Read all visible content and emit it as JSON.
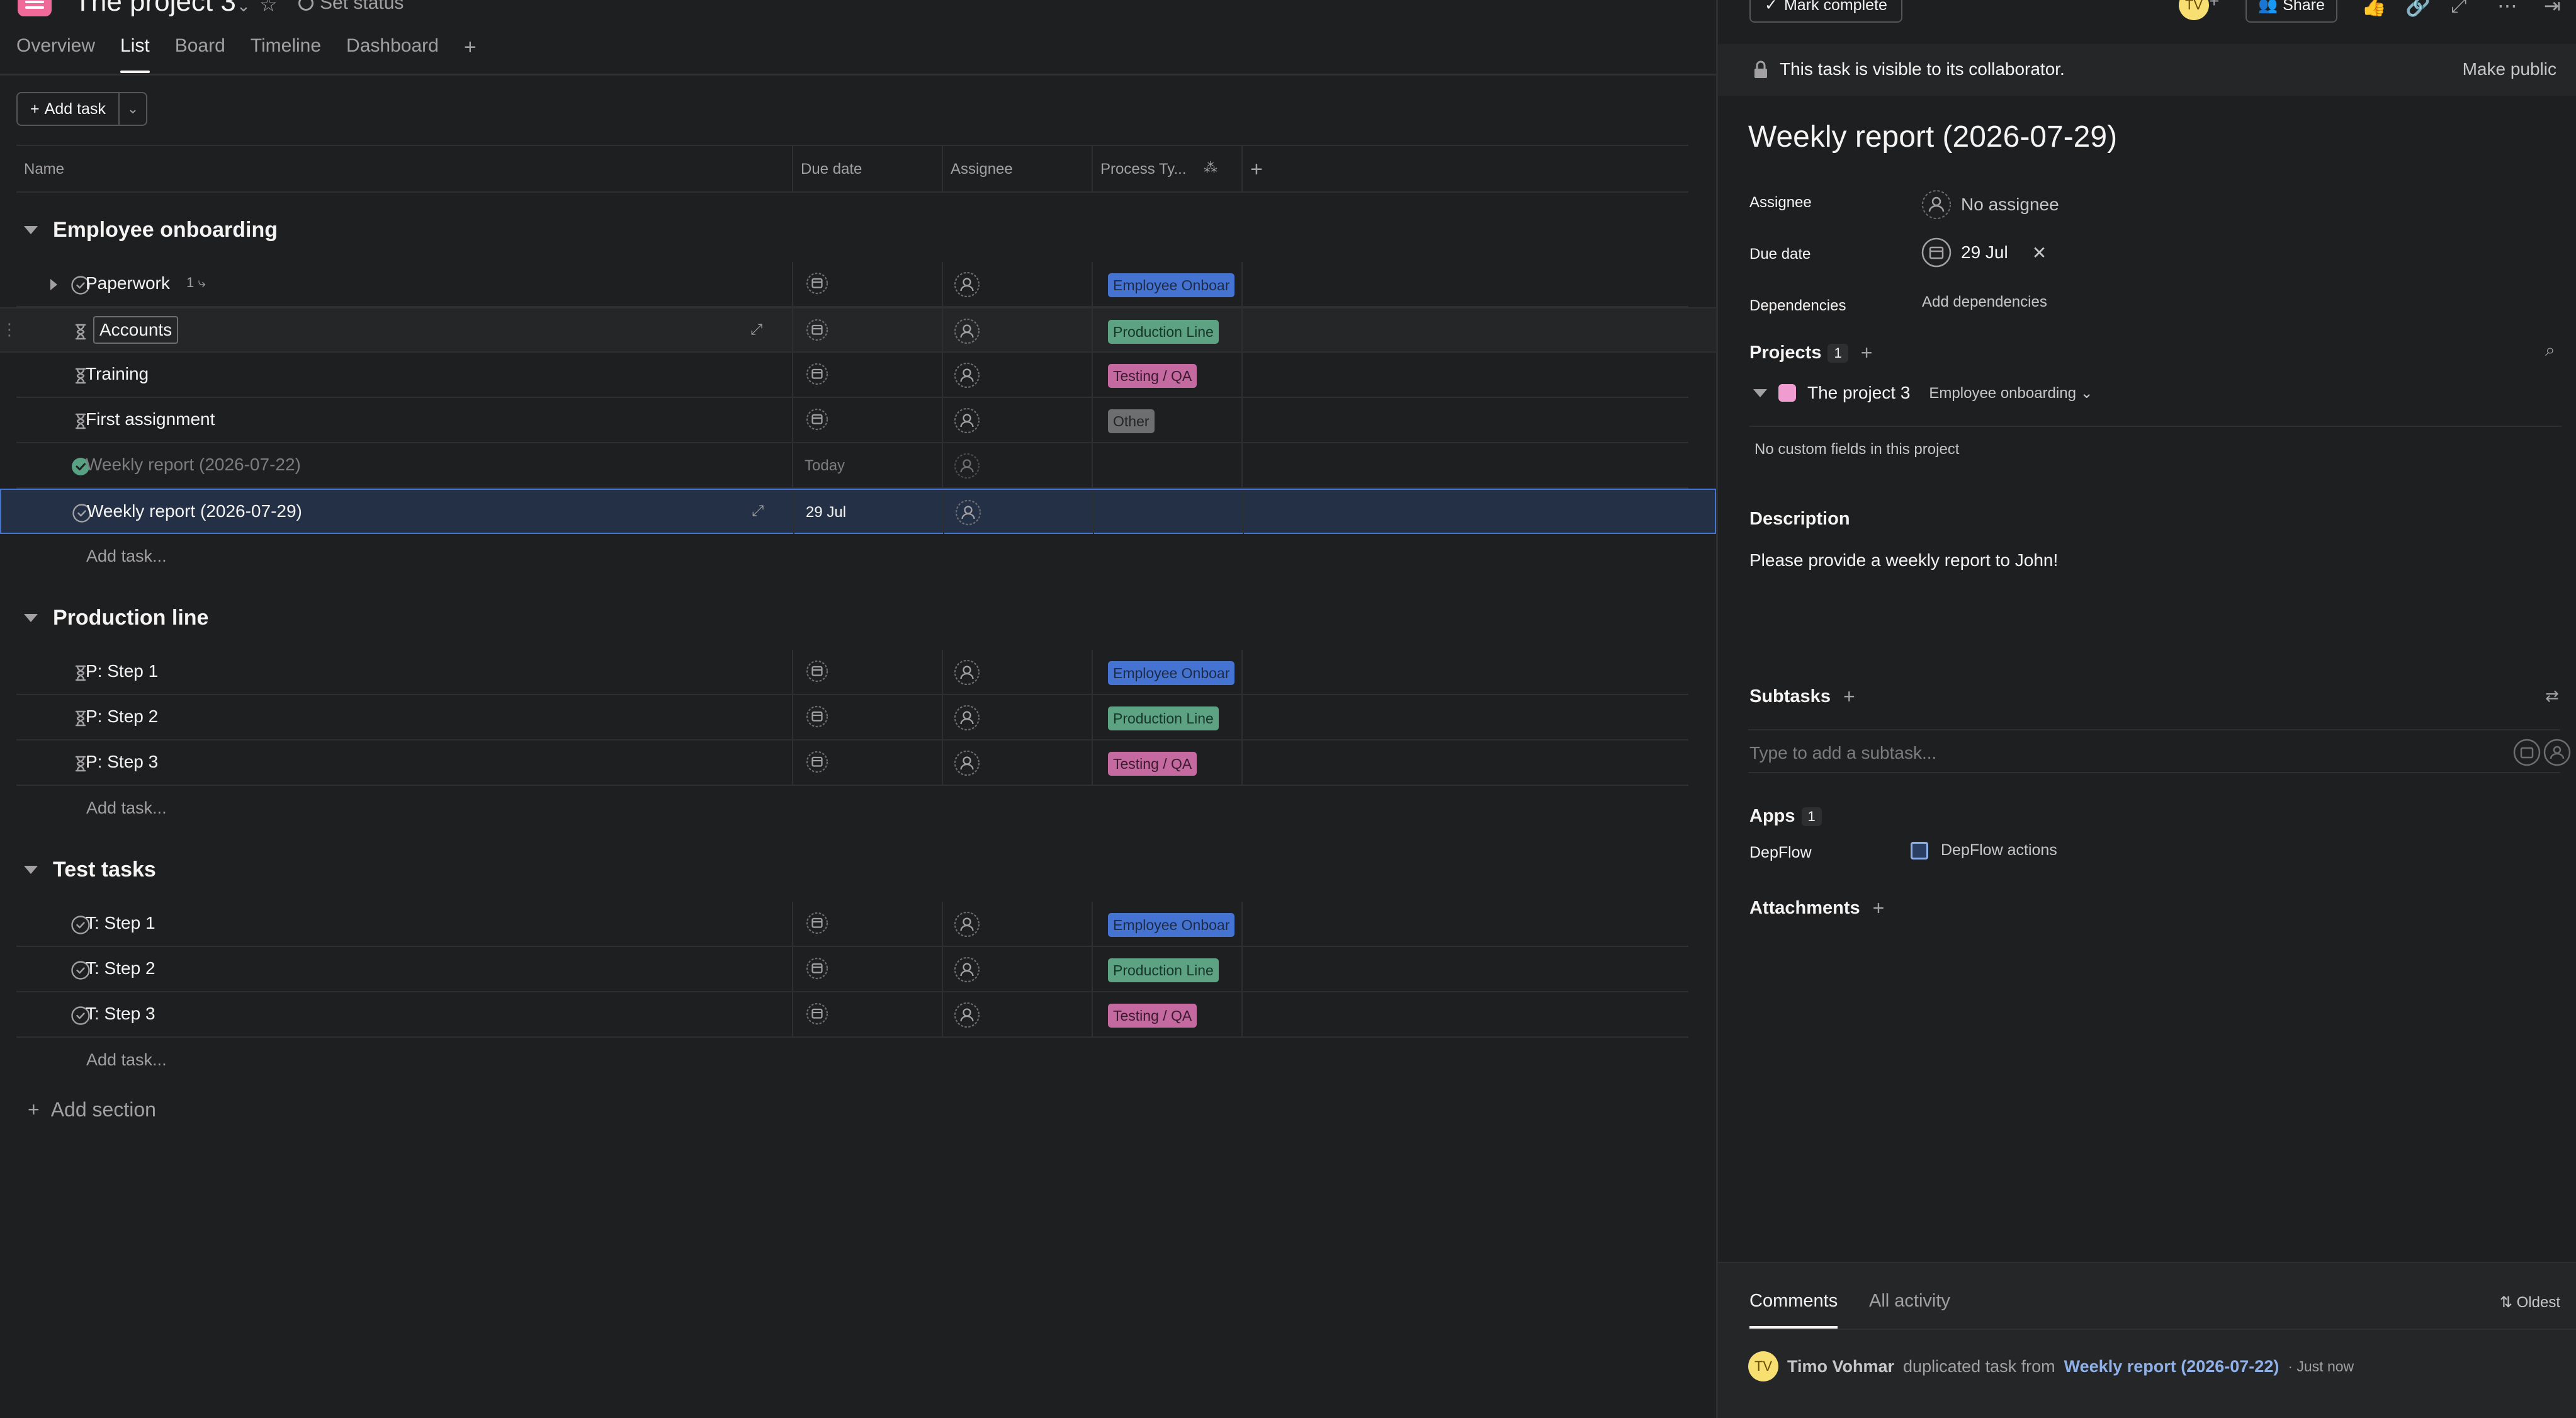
{
  "project": {
    "title": "The project 3",
    "set_status": "Set status",
    "tabs": [
      "Overview",
      "List",
      "Board",
      "Timeline",
      "Dashboard"
    ],
    "active_tab": "List"
  },
  "toolbar": {
    "add_task": "Add task"
  },
  "columns": {
    "name": "Name",
    "due": "Due date",
    "assignee": "Assignee",
    "process": "Process Ty..."
  },
  "sections": [
    {
      "title": "Employee onboarding",
      "add_task": "Add task...",
      "tasks": [
        {
          "name": "Paperwork",
          "icon": "check-circle",
          "subtasks": "1",
          "due": "",
          "tag": "Employee Onboar",
          "tag_color": "blue"
        },
        {
          "name": "Accounts",
          "icon": "hourglass",
          "due": "",
          "tag": "Production Line",
          "tag_color": "green"
        },
        {
          "name": "Training",
          "icon": "hourglass",
          "due": "",
          "tag": "Testing / QA",
          "tag_color": "pink"
        },
        {
          "name": "First assignment",
          "icon": "hourglass",
          "due": "",
          "tag": "Other",
          "tag_color": "grey"
        },
        {
          "name": "Weekly report (2026-07-22)",
          "icon": "check-done",
          "due": "Today",
          "tag": "",
          "tag_color": ""
        },
        {
          "name": "Weekly report (2026-07-29)",
          "icon": "check-circle",
          "due": "29 Jul",
          "tag": "",
          "tag_color": ""
        }
      ]
    },
    {
      "title": "Production line",
      "add_task": "Add task...",
      "tasks": [
        {
          "name": "P: Step 1",
          "icon": "hourglass",
          "due": "",
          "tag": "Employee Onboar",
          "tag_color": "blue"
        },
        {
          "name": "P: Step 2",
          "icon": "hourglass",
          "due": "",
          "tag": "Production Line",
          "tag_color": "green"
        },
        {
          "name": "P: Step 3",
          "icon": "hourglass",
          "due": "",
          "tag": "Testing / QA",
          "tag_color": "pink"
        }
      ]
    },
    {
      "title": "Test tasks",
      "add_task": "Add task...",
      "tasks": [
        {
          "name": "T: Step 1",
          "icon": "check-circle",
          "due": "",
          "tag": "Employee Onboar",
          "tag_color": "blue"
        },
        {
          "name": "T: Step 2",
          "icon": "check-circle",
          "due": "",
          "tag": "Production Line",
          "tag_color": "green"
        },
        {
          "name": "T: Step 3",
          "icon": "check-circle",
          "due": "",
          "tag": "Testing / QA",
          "tag_color": "pink"
        }
      ]
    }
  ],
  "add_section": "Add section",
  "detail": {
    "mark_complete": "Mark complete",
    "avatar_initials": "TV",
    "share": "Share",
    "visibility_text": "This task is visible to its collaborator.",
    "make_public": "Make public",
    "title": "Weekly report (2026-07-29)",
    "fields": {
      "assignee_label": "Assignee",
      "assignee_value": "No assignee",
      "due_label": "Due date",
      "due_value": "29 Jul",
      "dependencies_label": "Dependencies",
      "dependencies_value": "Add dependencies"
    },
    "projects_label": "Projects",
    "projects_count": "1",
    "project_name": "The project 3",
    "project_section": "Employee onboarding",
    "no_custom_fields": "No custom fields in this project",
    "description_label": "Description",
    "description_text": "Please provide a weekly report to John!",
    "subtasks_label": "Subtasks",
    "subtask_placeholder": "Type to add a subtask...",
    "apps_label": "Apps",
    "apps_count": "1",
    "app_name": "DepFlow",
    "app_action": "DepFlow actions",
    "attachments_label": "Attachments",
    "comments_tab": "Comments",
    "activity_tab": "All activity",
    "sort_label": "Oldest",
    "activity": {
      "initials": "TV",
      "user": "Timo Vohmar",
      "action": "duplicated task from",
      "link": "Weekly report (2026-07-22)",
      "time": "· Just now"
    }
  },
  "colors": {
    "accent": "#4573d2",
    "bg": "#1e1f21",
    "tag_blue": "#4573d2",
    "tag_green": "#5da283",
    "tag_pink": "#c46aa0",
    "tag_grey": "#6d6e6f"
  }
}
